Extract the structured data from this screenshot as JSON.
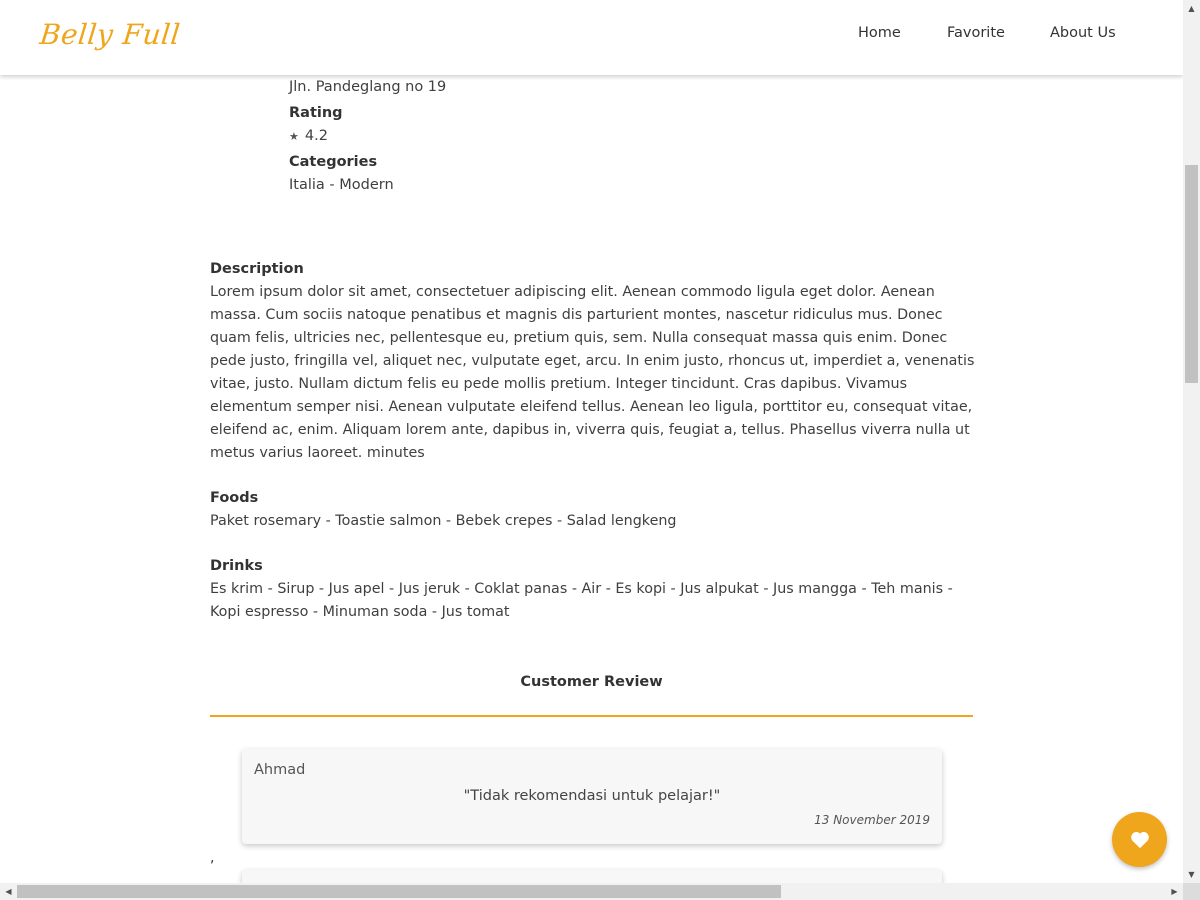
{
  "header": {
    "brand": "Belly Full",
    "nav": {
      "home": "Home",
      "favorite": "Favorite",
      "about": "About Us"
    }
  },
  "detail": {
    "address": "Jln. Pandeglang no 19",
    "rating_label": "Rating",
    "rating_icon": "star-icon",
    "rating_value": "4.2",
    "categories_label": "Categories",
    "categories_value": "Italia - Modern"
  },
  "description": {
    "label": "Description",
    "text": "Lorem ipsum dolor sit amet, consectetuer adipiscing elit. Aenean commodo ligula eget dolor. Aenean massa. Cum sociis natoque penatibus et magnis dis parturient montes, nascetur ridiculus mus. Donec quam felis, ultricies nec, pellentesque eu, pretium quis, sem. Nulla consequat massa quis enim. Donec pede justo, fringilla vel, aliquet nec, vulputate eget, arcu. In enim justo, rhoncus ut, imperdiet a, venenatis vitae, justo. Nullam dictum felis eu pede mollis pretium. Integer tincidunt. Cras dapibus. Vivamus elementum semper nisi. Aenean vulputate eleifend tellus. Aenean leo ligula, porttitor eu, consequat vitae, eleifend ac, enim. Aliquam lorem ante, dapibus in, viverra quis, feugiat a, tellus. Phasellus viverra nulla ut metus varius laoreet. minutes"
  },
  "foods": {
    "label": "Foods",
    "text": "Paket rosemary - Toastie salmon - Bebek crepes - Salad lengkeng"
  },
  "drinks": {
    "label": "Drinks",
    "text": "Es krim - Sirup - Jus apel - Jus jeruk - Coklat panas - Air - Es kopi - Jus alpukat - Jus mangga - Teh manis - Kopi espresso - Minuman soda - Jus tomat"
  },
  "reviews": {
    "heading": "Customer Review",
    "separator": ",",
    "items": [
      {
        "name": "Ahmad",
        "review": "\"Tidak rekomendasi untuk pelajar!\"",
        "date": "13 November 2019"
      }
    ]
  },
  "fab": {
    "icon": "heart-icon"
  },
  "colors": {
    "accent": "#efa51c"
  }
}
